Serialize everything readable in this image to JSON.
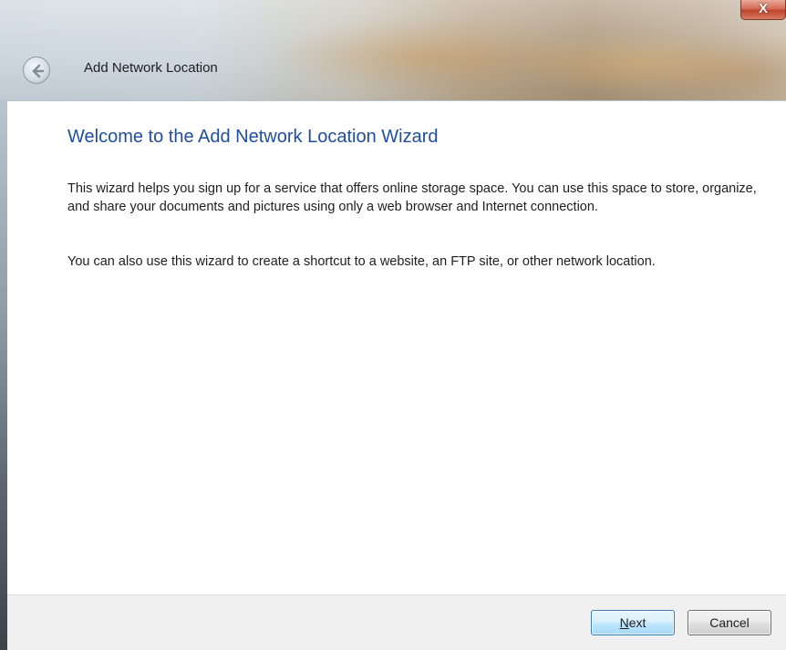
{
  "window": {
    "title": "Add Network Location",
    "close_label": "X"
  },
  "content": {
    "heading": "Welcome to the Add Network Location Wizard",
    "paragraph1": "This wizard helps you sign up for a service that offers online storage space.  You can use this space to store, organize, and share your documents and pictures using only a web browser and Internet connection.",
    "paragraph2": "You can also use this wizard to create a shortcut to a website, an FTP site, or other network location."
  },
  "footer": {
    "next_button": {
      "mnemonic": "N",
      "rest": "ext"
    },
    "cancel_label": "Cancel"
  },
  "icons": {
    "back": "back-arrow-icon",
    "close": "close-icon"
  },
  "colors": {
    "heading": "#1f4e9a",
    "close_button": "#c0422a",
    "footer_bg": "#f0f0f0"
  }
}
